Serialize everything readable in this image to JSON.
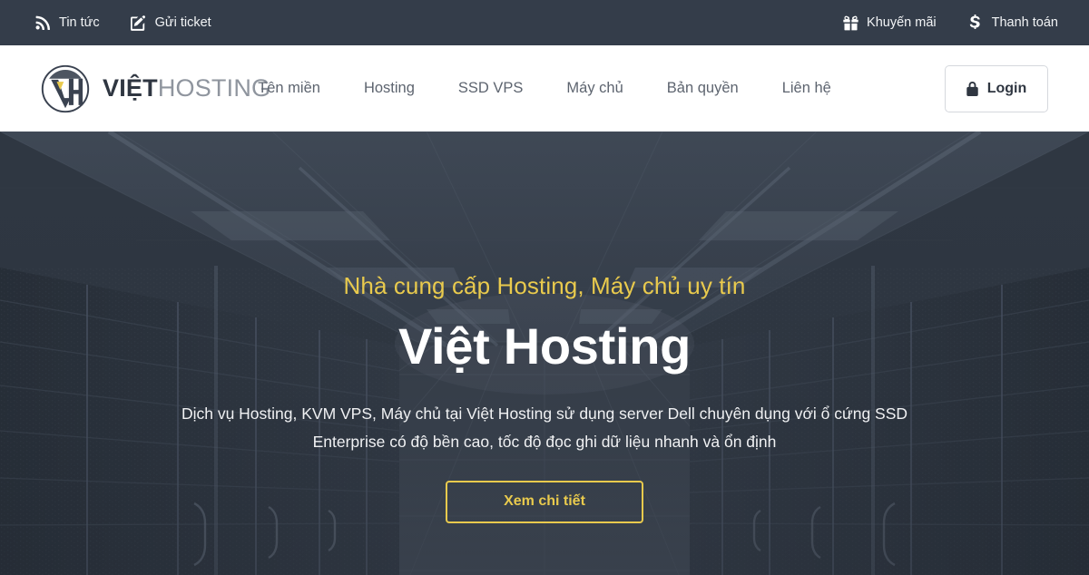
{
  "topbar": {
    "background": "#343d4a",
    "left_links": [
      {
        "label": "Tin tức",
        "icon": "rss-icon"
      },
      {
        "label": "Gửi ticket",
        "icon": "edit-square-icon"
      }
    ],
    "right_links": [
      {
        "label": "Khuyến mãi",
        "icon": "gift-icon"
      },
      {
        "label": "Thanh toán",
        "icon": "dollar-icon"
      }
    ]
  },
  "header": {
    "logo": {
      "icon": "vh-monogram-icon",
      "text_bold": "VIỆT",
      "text_light": "HOSTING",
      "accent_color": "#e9ca4d"
    },
    "nav": [
      {
        "label": "Tên miền"
      },
      {
        "label": "Hosting"
      },
      {
        "label": "SSD VPS"
      },
      {
        "label": "Máy chủ"
      },
      {
        "label": "Bản quyền"
      },
      {
        "label": "Liên hệ"
      }
    ],
    "login": {
      "label": "Login",
      "icon": "lock-icon"
    }
  },
  "hero": {
    "eyebrow": "Nhà cung cấp Hosting, Máy chủ uy tín",
    "title": "Việt Hosting",
    "subtitle": "Dịch vụ Hosting, KVM VPS, Máy chủ tại Việt Hosting sử dụng server Dell chuyên dụng với ổ cứng SSD Enterprise có độ bền cao, tốc độ đọc ghi dữ liệu nhanh và ổn định",
    "cta_label": "Xem chi tiết",
    "accent_color": "#e9ca4d",
    "background_image": "data-center-server-room-photo"
  }
}
